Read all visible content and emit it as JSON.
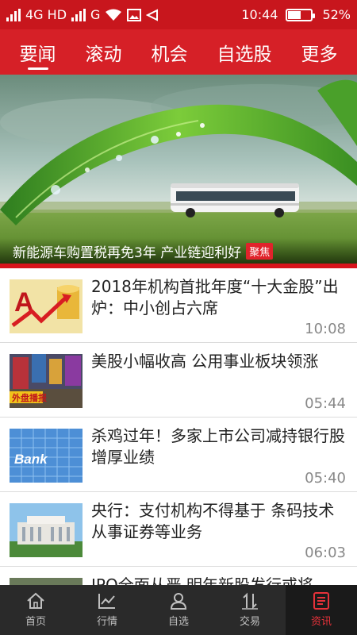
{
  "status_bar": {
    "network_1": "4G HD",
    "network_2": "G",
    "time": "10:44",
    "battery": "52%",
    "battery_level": 0.52
  },
  "tabs": [
    {
      "label": "要闻",
      "active": true
    },
    {
      "label": "滚动",
      "active": false
    },
    {
      "label": "机会",
      "active": false
    },
    {
      "label": "自选股",
      "active": false
    },
    {
      "label": "更多",
      "active": false
    }
  ],
  "banner": {
    "caption": "新能源车购置税再免3年 产业链迎利好",
    "badge": "聚焦"
  },
  "news": [
    {
      "title": "2018年机构首批年度“十大金股”出炉：中小创占六席",
      "time": "10:08",
      "thumb": "arrow-chart-thumbnail"
    },
    {
      "title": "美股小幅收高 公用事业板块领涨",
      "time": "05:44",
      "thumb": "times-square-thumbnail",
      "thumb_label": "外盘播报"
    },
    {
      "title": "杀鸡过年！多家上市公司减持银行股增厚业绩",
      "time": "05:40",
      "thumb": "bank-thumbnail",
      "thumb_label": "Bank"
    },
    {
      "title": "央行：支付机构不得基于 条码技术从事证券等业务",
      "time": "06:03",
      "thumb": "central-bank-building-thumbnail"
    },
    {
      "title": "IPO全面从严 明年新股发行或将",
      "time": "",
      "thumb": "partial-thumbnail"
    }
  ],
  "bottom_nav": [
    {
      "label": "首页",
      "icon": "home-icon",
      "active": false
    },
    {
      "label": "行情",
      "icon": "chart-icon",
      "active": false
    },
    {
      "label": "自选",
      "icon": "person-icon",
      "active": false
    },
    {
      "label": "交易",
      "icon": "trade-arrows-icon",
      "active": false
    },
    {
      "label": "资讯",
      "icon": "news-doc-icon",
      "active": true
    }
  ],
  "colors": {
    "brand_red": "#d62027",
    "status_red": "#c8161d",
    "nav_dark": "#2a2a2a",
    "active_nav": "#e8323a"
  }
}
